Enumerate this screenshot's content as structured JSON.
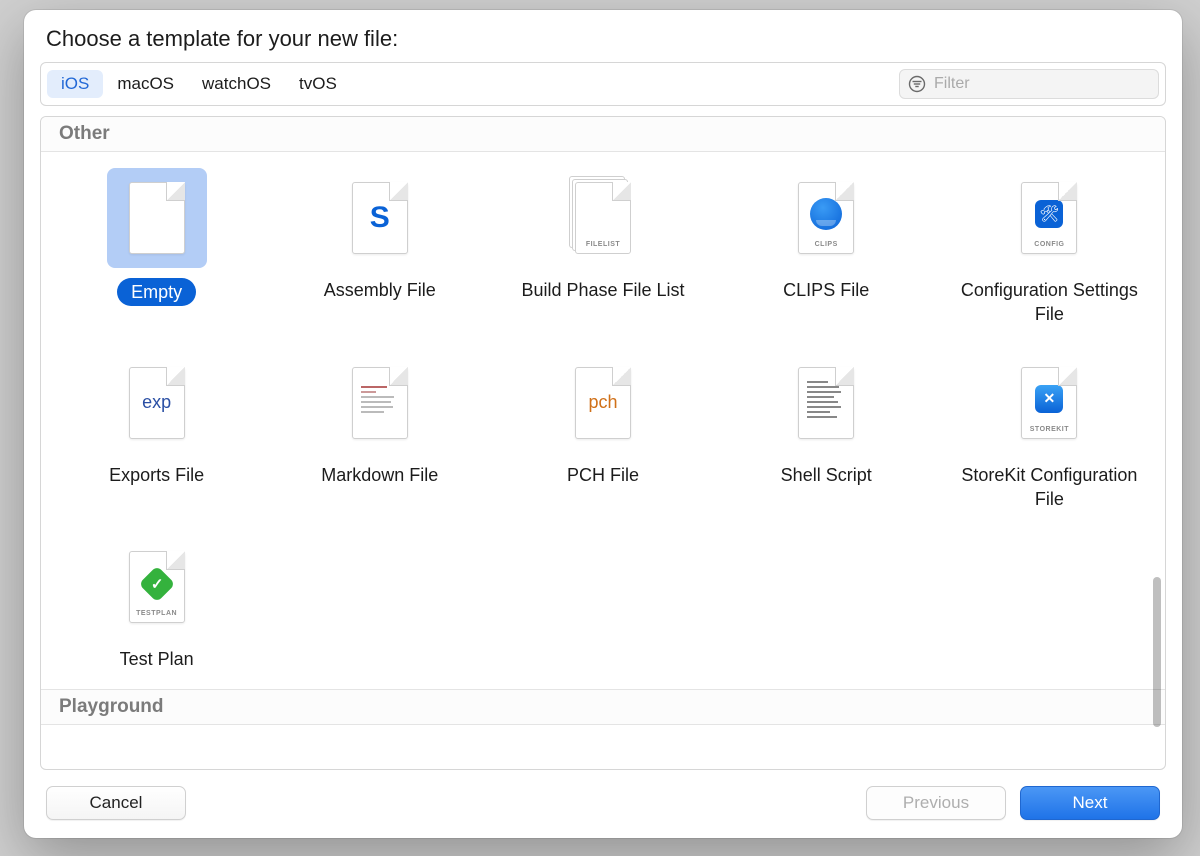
{
  "dialog": {
    "title": "Choose a template for your new file:"
  },
  "platforms": {
    "items": [
      {
        "id": "ios",
        "label": "iOS",
        "selected": true
      },
      {
        "id": "macos",
        "label": "macOS",
        "selected": false
      },
      {
        "id": "watchos",
        "label": "watchOS",
        "selected": false
      },
      {
        "id": "tvos",
        "label": "tvOS",
        "selected": false
      }
    ]
  },
  "filter": {
    "placeholder": "Filter",
    "value": ""
  },
  "sections": [
    {
      "id": "other",
      "title": "Other",
      "templates": [
        {
          "id": "empty",
          "label": "Empty",
          "icon_caption": "",
          "selected": true
        },
        {
          "id": "assembly-file",
          "label": "Assembly File",
          "icon_caption": "",
          "selected": false
        },
        {
          "id": "build-phase-filelist",
          "label": "Build Phase File List",
          "icon_caption": "FILELIST",
          "selected": false
        },
        {
          "id": "clips-file",
          "label": "CLIPS File",
          "icon_caption": "CLIPS",
          "selected": false
        },
        {
          "id": "config-settings",
          "label": "Configuration Settings File",
          "icon_caption": "CONFIG",
          "selected": false
        },
        {
          "id": "exports-file",
          "label": "Exports File",
          "icon_caption": "",
          "selected": false
        },
        {
          "id": "markdown-file",
          "label": "Markdown File",
          "icon_caption": "",
          "selected": false
        },
        {
          "id": "pch-file",
          "label": "PCH File",
          "icon_caption": "",
          "selected": false
        },
        {
          "id": "shell-script",
          "label": "Shell Script",
          "icon_caption": "",
          "selected": false
        },
        {
          "id": "storekit-config",
          "label": "StoreKit Configuration File",
          "icon_caption": "STOREKIT",
          "selected": false
        },
        {
          "id": "test-plan",
          "label": "Test Plan",
          "icon_caption": "TESTPLAN",
          "selected": false
        }
      ]
    },
    {
      "id": "playground",
      "title": "Playground",
      "templates": []
    }
  ],
  "buttons": {
    "cancel": "Cancel",
    "previous": "Previous",
    "next": "Next"
  }
}
